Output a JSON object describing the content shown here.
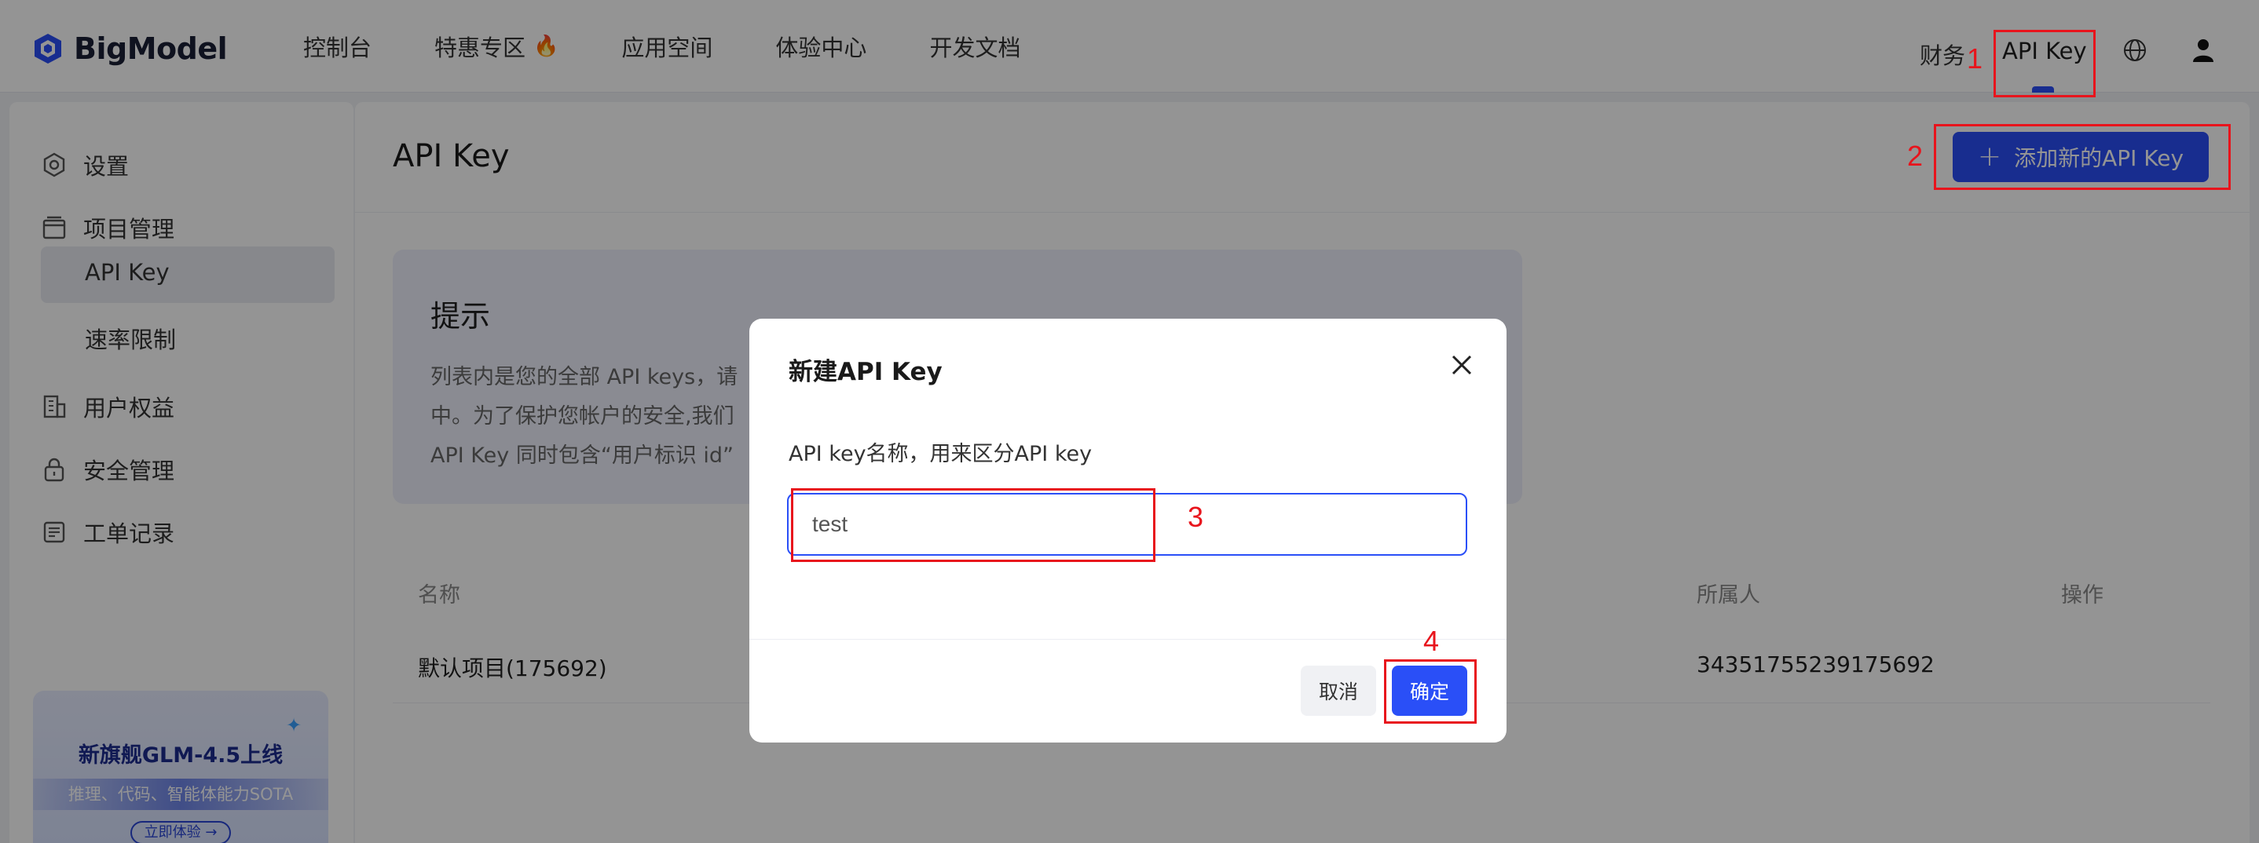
{
  "brand": {
    "name": "BigModel"
  },
  "nav": {
    "items": [
      "控制台",
      "特惠专区",
      "应用空间",
      "体验中心",
      "开发文档"
    ],
    "promo_emoji": "🔥",
    "finance": "财务",
    "api_key": "API Key"
  },
  "sidebar": {
    "settings": "设置",
    "project": "项目管理",
    "api_key": "API Key",
    "rate_limit": "速率限制",
    "benefits": "用户权益",
    "security": "安全管理",
    "tickets": "工单记录",
    "promo": {
      "title": "新旗舰GLM-4.5上线",
      "subtitle": "推理、代码、智能体能力SOTA",
      "button": "立即体验 →"
    }
  },
  "main": {
    "title": "API Key",
    "add_button": "添加新的API Key",
    "tip": {
      "title": "提示",
      "lines": [
        "列表内是您的全部 API keys，请",
        "中。为了保护您帐户的安全,我们",
        "API Key 同时包含“用户标识 id”"
      ]
    },
    "table": {
      "headers": {
        "name": "名称",
        "owner": "所属人",
        "action": "操作"
      },
      "rows": [
        {
          "name": "默认项目(175692)",
          "owner": "34351755239175692"
        }
      ]
    }
  },
  "modal": {
    "title": "新建API Key",
    "label": "API key名称，用来区分API key",
    "input_value": "test",
    "cancel": "取消",
    "confirm": "确定"
  },
  "annotations": [
    "1",
    "2",
    "3",
    "4"
  ],
  "colors": {
    "accent": "#2a4ff7",
    "annotation": "#e8141c"
  }
}
